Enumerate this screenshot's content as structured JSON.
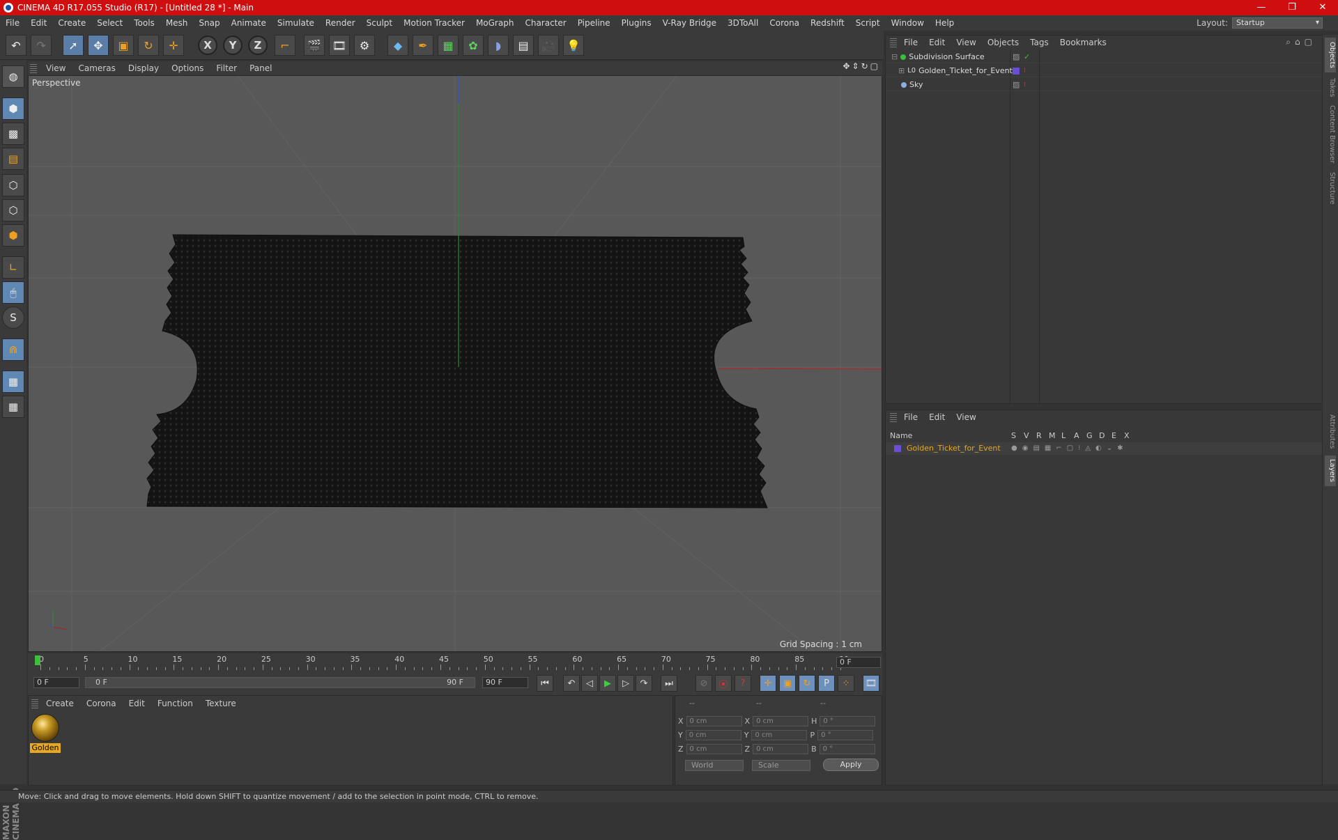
{
  "window": {
    "title": "CINEMA 4D R17.055 Studio (R17) - [Untitled 28 *] - Main",
    "minimize": "—",
    "restore": "❐",
    "close": "✕"
  },
  "menu": [
    "File",
    "Edit",
    "Create",
    "Select",
    "Tools",
    "Mesh",
    "Snap",
    "Animate",
    "Simulate",
    "Render",
    "Sculpt",
    "Motion Tracker",
    "MoGraph",
    "Character",
    "Pipeline",
    "Plugins",
    "V-Ray Bridge",
    "3DToAll",
    "Corona",
    "Redshift",
    "Script",
    "Window",
    "Help"
  ],
  "layout": {
    "label": "Layout:",
    "value": "Startup"
  },
  "toolbar": {
    "axis_x": "X",
    "axis_y": "Y",
    "axis_z": "Z"
  },
  "viewport": {
    "menu": [
      "View",
      "Cameras",
      "Display",
      "Options",
      "Filter",
      "Panel"
    ],
    "label": "Perspective",
    "grid_spacing": "Grid Spacing : 1 cm"
  },
  "timeline": {
    "ticks": [
      "0",
      "5",
      "10",
      "15",
      "20",
      "25",
      "30",
      "35",
      "40",
      "45",
      "50",
      "55",
      "60",
      "65",
      "70",
      "75",
      "80",
      "85",
      "90"
    ],
    "current_frame": "0 F"
  },
  "playbar": {
    "start": "0 F",
    "range_start": "0 F",
    "range_end": "90 F",
    "end": "90 F"
  },
  "material_manager": {
    "menu": [
      "Create",
      "Corona",
      "Edit",
      "Function",
      "Texture"
    ],
    "material_name": "Golden"
  },
  "coordinates": {
    "header": [
      "--",
      "--",
      "--"
    ],
    "rows": [
      {
        "a": "X",
        "av": "0 cm",
        "b": "X",
        "bv": "0 cm",
        "c": "H",
        "cv": "0 °"
      },
      {
        "a": "Y",
        "av": "0 cm",
        "b": "Y",
        "bv": "0 cm",
        "c": "P",
        "cv": "0 °"
      },
      {
        "a": "Z",
        "av": "0 cm",
        "b": "Z",
        "bv": "0 cm",
        "c": "B",
        "cv": "0 °"
      }
    ],
    "mode": "World",
    "mode2": "Scale",
    "apply": "Apply"
  },
  "object_manager": {
    "menu": [
      "File",
      "Edit",
      "View",
      "Objects",
      "Tags",
      "Bookmarks"
    ],
    "objects": [
      {
        "name": "Subdivision Surface",
        "indent": 0
      },
      {
        "name": "Golden_Ticket_for_Event",
        "indent": 1
      },
      {
        "name": "Sky",
        "indent": 0
      }
    ]
  },
  "layer_manager": {
    "menu": [
      "File",
      "Edit",
      "View"
    ],
    "columns": [
      "Name",
      "S",
      "V",
      "R",
      "M",
      "L",
      "A",
      "G",
      "D",
      "E",
      "X"
    ],
    "layer_name": "Golden_Ticket_for_Event"
  },
  "right_tabs": [
    "Objects",
    "Takes",
    "Content Browser",
    "Structure",
    "Attributes",
    "Layers"
  ],
  "status": "Move: Click and drag to move elements. Hold down SHIFT to quantize movement / add to the selection in point mode, CTRL to remove.",
  "colors": {
    "titlebar": "#cf0f0f",
    "accent": "#e6a820",
    "layer": "#6a4fd6"
  }
}
